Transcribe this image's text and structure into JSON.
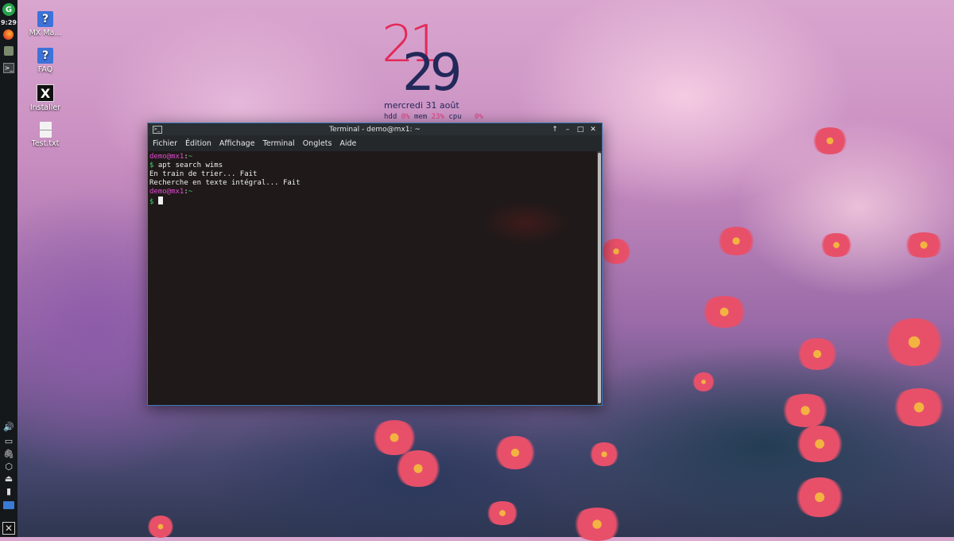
{
  "panel": {
    "time": "9:29",
    "launchers": [
      {
        "name": "g-icon",
        "glyph": "G"
      },
      {
        "name": "firefox-icon",
        "glyph": ""
      },
      {
        "name": "file-manager-icon",
        "glyph": ""
      },
      {
        "name": "terminal-icon",
        "glyph": ">_"
      }
    ],
    "tray": [
      "volume-icon",
      "screen-icon",
      "clip-icon",
      "box-icon",
      "eject-icon",
      "battery-icon",
      "network-icon",
      "mx-menu-icon"
    ]
  },
  "desktop_icons": [
    {
      "label": "MX Ma...",
      "icon": "help-icon",
      "glyph": "?"
    },
    {
      "label": "FAQ",
      "icon": "help-icon",
      "glyph": "?"
    },
    {
      "label": "Installer",
      "icon": "installer-icon",
      "glyph": "X"
    },
    {
      "label": "Test.txt",
      "icon": "text-file-icon",
      "glyph": ""
    }
  ],
  "conky": {
    "hour": "21",
    "minute": "29",
    "date": "mercredi  31 août",
    "stats": {
      "hdd_label": "hdd",
      "hdd": "0%",
      "mem_label": "mem",
      "mem": "23%",
      "cpu_label": "cpu",
      "cpu": "0%"
    }
  },
  "terminal": {
    "title": "Terminal - demo@mx1: ~",
    "title_icon": ">_",
    "controls": {
      "up": "↑",
      "minimize": "–",
      "maximize": "□",
      "close": "✕"
    },
    "menu": [
      "Fichier",
      "Édition",
      "Affichage",
      "Terminal",
      "Onglets",
      "Aide"
    ],
    "lines": {
      "p1_user": "demo@mx1",
      "p1_sep": ":",
      "p1_path": "~",
      "cmd_prompt": "$",
      "cmd": " apt search wims",
      "out1": "En train de trier... Fait",
      "out2": "Recherche en texte intégral... Fait",
      "p2_user": "demo@mx1",
      "p2_sep": ":",
      "p2_path": "~",
      "p2_prompt": "$"
    }
  }
}
